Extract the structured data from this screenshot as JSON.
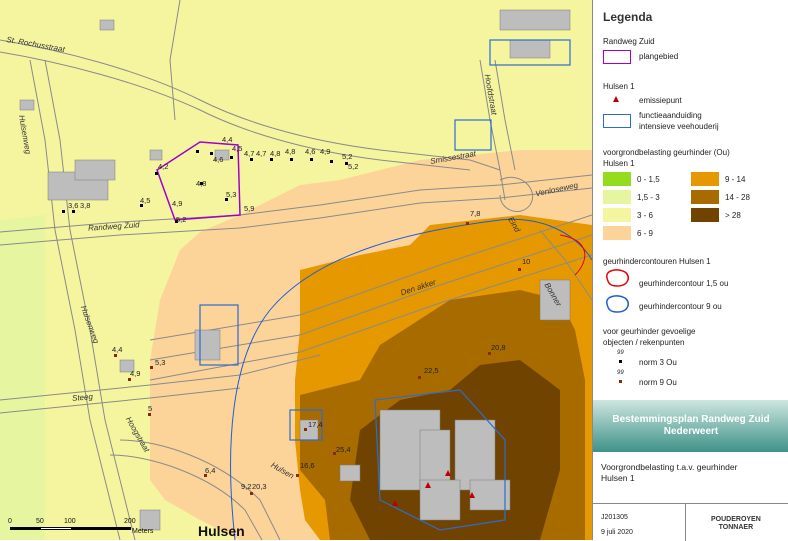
{
  "map": {
    "street_names": {
      "st_rochusstraat": "St. Rochusstraat",
      "hulsenweg_n": "Hulsenweg",
      "randweg_zuid": "Randweg Zuid",
      "smissestraat": "Smissestraat",
      "hoofdstraat": "Hoofdstraat",
      "venloseweg": "Venloseweg",
      "den_akker": "Den akker",
      "hulsenweg_s": "Hulsenweg",
      "steeg": "Steeg",
      "hoogstraat": "Hoogstraat",
      "hulsen_road": "Hulsen",
      "bonnern": "Bonner",
      "eind": "Eind"
    },
    "town_name": "Hulsen",
    "point_labels": [
      "3,6",
      "3,8",
      "4,5",
      "4,2",
      "4,9",
      "5,2",
      "4,6",
      "4,4",
      "4,5",
      "4,7",
      "4,8",
      "4,8",
      "5,2",
      "4,6",
      "4,7",
      "4,9",
      "5,2",
      "5,3",
      "5,9",
      "4,8",
      "7,8",
      "10",
      "20,8",
      "22,5",
      "17,4",
      "25,4",
      "16,6",
      "6,4",
      "9,2",
      "20,3",
      "4,4",
      "4,9",
      "5,3",
      "5"
    ],
    "scale": {
      "ticks": [
        "0",
        "50",
        "100",
        "200"
      ],
      "unit": "Meters"
    },
    "colors": {
      "band_0_15": "#96dc1e",
      "band_15_3": "#e6f5a0",
      "band_3_6": "#f5f5a0",
      "band_6_9": "#fcd49a",
      "band_9_14": "#e69800",
      "band_14_28": "#a86b00",
      "band_28": "#704400",
      "plangebied": "#a300cc",
      "contour_15": "#e60000",
      "contour_9": "#1e5cd2",
      "facility": "#2b6cd1"
    }
  },
  "legend": {
    "title": "Legenda",
    "section1_title": "Randweg Zuid",
    "plangebied_label": "plangebied",
    "section2_title": "Hulsen 1",
    "emissiepunt_label": "emissiepunt",
    "functie_label_1": "functieaanduiding",
    "functie_label_2": "intensieve veehouderij",
    "voorgrond_title_1": "voorgrondbelasting geurhinder (Ou)",
    "voorgrond_title_2": "Hulsen 1",
    "classes": [
      {
        "label": "0 - 1,5",
        "color": "#96dc1e"
      },
      {
        "label": "1,5 - 3",
        "color": "#e6f5a0"
      },
      {
        "label": "3 - 6",
        "color": "#f5f5a0"
      },
      {
        "label": "6 - 9",
        "color": "#fcd49a"
      },
      {
        "label": "9 - 14",
        "color": "#e69800"
      },
      {
        "label": "14 - 28",
        "color": "#a86b00"
      },
      {
        "label": "> 28",
        "color": "#704400"
      }
    ],
    "contours_title": "geurhindercontouren Hulsen 1",
    "contour_15_label": "geurhindercontour 1,5 ou",
    "contour_9_label": "geurhindercontour 9 ou",
    "objects_title_1": "voor geurhinder gevoelige",
    "objects_title_2": "objecten / rekenpunten",
    "norm3_label": "norm 3 Ou",
    "norm9_label": "norm 9 Ou",
    "symbol_99": "99"
  },
  "titleblock": {
    "title_line1": "Bestemmingsplan Randweg Zuid",
    "title_line2": "Nederweert",
    "desc_line1": "Voorgrondbelasting t.a.v. geurhinder",
    "desc_line2": "Hulsen 1",
    "code": "J201305",
    "date": "9 juli 2020",
    "logo_line1": "POUDEROYEN",
    "logo_line2": "TONNAER"
  }
}
